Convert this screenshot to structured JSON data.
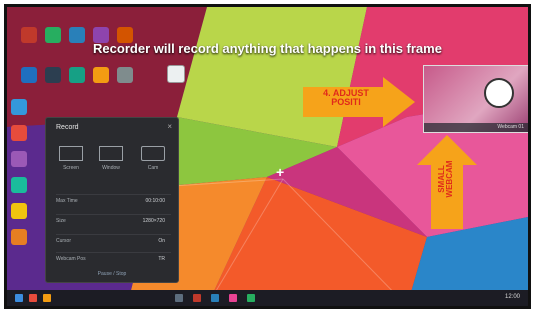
{
  "banner": {
    "text": "Recorder will record anything that happens in this frame"
  },
  "recorder": {
    "title": "Record",
    "close": "×",
    "modes": [
      {
        "label": "Screen"
      },
      {
        "label": "Window"
      },
      {
        "label": "Cam"
      }
    ],
    "settings": [
      {
        "key": "Max Time",
        "value": "00:10:00"
      },
      {
        "key": "Size",
        "value": "1280×720"
      },
      {
        "key": "Cursor",
        "value": "On"
      },
      {
        "key": "Webcam Pos",
        "value": "TR"
      }
    ],
    "footer": "Pause / Stop"
  },
  "annotations": {
    "adjust_label": "4. ADJUST\nPOSITI",
    "small_label": "SMALL\nWEBCAM"
  },
  "webcam": {
    "caption": "Webcam 01"
  },
  "taskbar": {
    "clock": "12:00"
  },
  "colors": {
    "arrow": "#f6a31a",
    "banner_text": "#ffffff",
    "recorder_bg": "#2a2b2f"
  }
}
